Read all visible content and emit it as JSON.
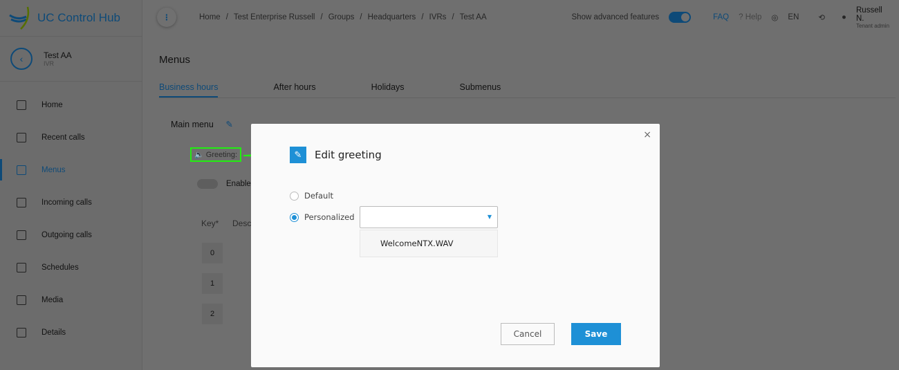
{
  "app": {
    "title": "UC Control Hub"
  },
  "context": {
    "name": "Test AA",
    "type": "IVR"
  },
  "sidebar": {
    "items": [
      {
        "label": "Home"
      },
      {
        "label": "Recent calls"
      },
      {
        "label": "Menus"
      },
      {
        "label": "Incoming calls"
      },
      {
        "label": "Outgoing calls"
      },
      {
        "label": "Schedules"
      },
      {
        "label": "Media"
      },
      {
        "label": "Details"
      }
    ]
  },
  "breadcrumb": [
    "Home",
    "/",
    "Test Enterprise Russell",
    "/",
    "Groups",
    "/",
    "Headquarters",
    "/",
    "IVRs",
    "/",
    "Test AA"
  ],
  "header": {
    "advanced": "Show advanced features",
    "faq": "FAQ",
    "help": "? Help",
    "lang": "EN",
    "user": "Russell N.",
    "role": "Tenant admin"
  },
  "page": {
    "title": "Menus",
    "tabs": [
      "Business hours",
      "After hours",
      "Holidays",
      "Submenus"
    ],
    "main_menu": "Main menu",
    "greeting": "Greeting:",
    "enable": "Enable",
    "key_header": "Key*",
    "desc_header": "Desc",
    "keys": [
      "0",
      "1",
      "2"
    ]
  },
  "modal": {
    "title": "Edit greeting",
    "default": "Default",
    "personalized": "Personalized",
    "select_value": "",
    "option": "WelcomeNTX.WAV",
    "cancel": "Cancel",
    "save": "Save",
    "close": "×"
  },
  "colors": {
    "accent": "#1b75bb",
    "button": "#1e90d6",
    "highlight": "#22ee11"
  }
}
